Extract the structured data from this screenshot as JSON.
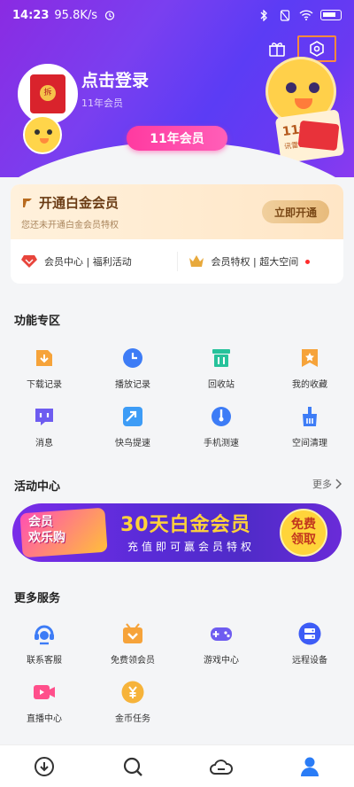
{
  "status": {
    "time": "14:23",
    "speed": "95.8K/s",
    "icons": [
      "alarm-icon",
      "bluetooth-icon",
      "no-sim-icon",
      "wifi-icon",
      "battery-icon"
    ]
  },
  "header": {
    "login_text": "点击登录",
    "subtitle": "11年会员",
    "badge": "11年会员",
    "deco_card": "11年",
    "deco_card_sub": "讯雷会员"
  },
  "vip": {
    "title": "开通白金会员",
    "desc": "您还未开通白金会员特权",
    "button": "立即开通",
    "link1": "会员中心 | 福利活动",
    "link2": "会员特权 | 超大空间"
  },
  "features": {
    "title": "功能专区",
    "items": [
      {
        "label": "下载记录",
        "icon": "download-record-icon",
        "color": "#f6a33a"
      },
      {
        "label": "播放记录",
        "icon": "play-record-icon",
        "color": "#3d7cf6"
      },
      {
        "label": "回收站",
        "icon": "recycle-bin-icon",
        "color": "#27c29b"
      },
      {
        "label": "我的收藏",
        "icon": "favorites-icon",
        "color": "#f6a33a"
      },
      {
        "label": "消息",
        "icon": "message-icon",
        "color": "#6e5cf0"
      },
      {
        "label": "快鸟提速",
        "icon": "speed-boost-icon",
        "color": "#3d9cf6"
      },
      {
        "label": "手机测速",
        "icon": "speed-test-icon",
        "color": "#3d7cf6"
      },
      {
        "label": "空间清理",
        "icon": "space-clean-icon",
        "color": "#3d7cf6"
      }
    ]
  },
  "activity": {
    "title": "活动中心",
    "more": "更多",
    "banner": {
      "left_line1": "会员",
      "left_line2": "欢乐购",
      "main": "30天白金会员",
      "sub": "充值即可赢会员特权",
      "badge_line1": "免费",
      "badge_line2": "领取"
    }
  },
  "services": {
    "title": "更多服务",
    "items": [
      {
        "label": "联系客服",
        "icon": "customer-service-icon",
        "color": "#3d7cf6"
      },
      {
        "label": "免费领会员",
        "icon": "free-vip-icon",
        "color": "#f6a33a"
      },
      {
        "label": "游戏中心",
        "icon": "game-center-icon",
        "color": "#6e5cf0"
      },
      {
        "label": "远程设备",
        "icon": "remote-device-icon",
        "color": "#3d5cf6"
      },
      {
        "label": "直播中心",
        "icon": "live-center-icon",
        "color": "#ff4f8b"
      },
      {
        "label": "金币任务",
        "icon": "coin-task-icon",
        "color": "#f6b33a"
      }
    ]
  },
  "nav": {
    "items": [
      "download-icon",
      "search-icon",
      "cloud-icon",
      "profile-icon"
    ],
    "active": "profile-icon"
  }
}
